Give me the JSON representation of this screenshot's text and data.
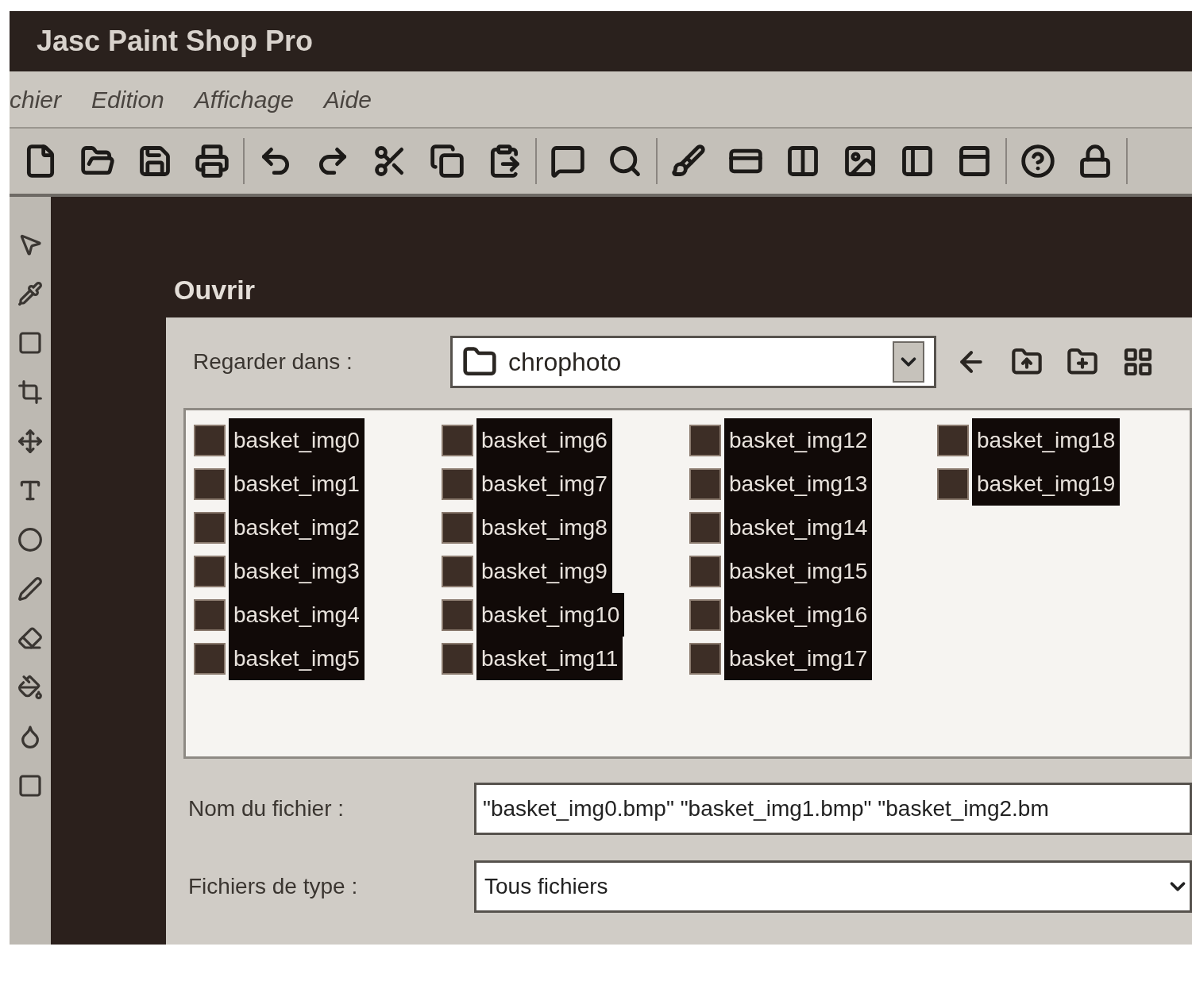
{
  "window": {
    "title": "Jasc Paint Shop Pro"
  },
  "menu": [
    "chier",
    "Edition",
    "Affichage",
    "Aide"
  ],
  "dialog": {
    "title": "Ouvrir",
    "look_in": {
      "label": "Regarder dans :",
      "value": "chrophoto"
    },
    "file_list": {
      "columns": [
        {
          "items": [
            {
              "name": "basket_img0",
              "selected": true
            },
            {
              "name": "basket_img1",
              "selected": true
            },
            {
              "name": "basket_img2",
              "selected": true
            },
            {
              "name": "basket_img3",
              "selected": true
            },
            {
              "name": "basket_img4",
              "selected": true
            },
            {
              "name": "basket_img5",
              "selected": true
            }
          ]
        },
        {
          "items": [
            {
              "name": "basket_img6",
              "selected": true
            },
            {
              "name": "basket_img7",
              "selected": true
            },
            {
              "name": "basket_img8",
              "selected": true
            },
            {
              "name": "basket_img9",
              "selected": true
            },
            {
              "name": "basket_img10",
              "selected": true
            },
            {
              "name": "basket_img11",
              "selected": true
            }
          ]
        },
        {
          "items": [
            {
              "name": "basket_img12",
              "selected": true
            },
            {
              "name": "basket_img13",
              "selected": true
            },
            {
              "name": "basket_img14",
              "selected": true
            },
            {
              "name": "basket_img15",
              "selected": true
            },
            {
              "name": "basket_img16",
              "selected": true
            },
            {
              "name": "basket_img17",
              "selected": true
            }
          ]
        },
        {
          "items": [
            {
              "name": "basket_img18",
              "selected": true
            },
            {
              "name": "basket_img19",
              "selected": true
            }
          ]
        }
      ]
    },
    "file_name": {
      "label": "Nom du fichier :",
      "value": "\"basket_img0.bmp\" \"basket_img1.bmp\" \"basket_img2.bm"
    },
    "file_type": {
      "label": "Fichiers de type :",
      "value": "Tous fichiers"
    }
  }
}
